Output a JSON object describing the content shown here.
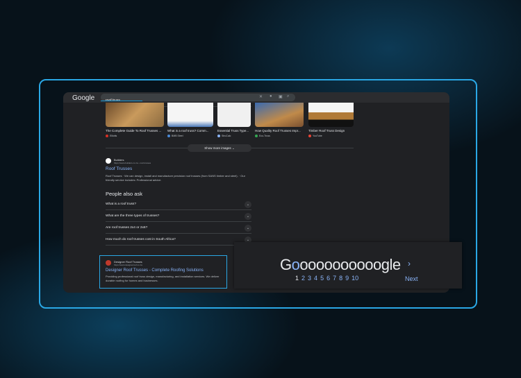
{
  "header": {
    "logo": "Google",
    "query": "roof truss"
  },
  "images": [
    {
      "caption": "The Complete Guide To Roof Trusses ...",
      "source": "Elliotts",
      "color": "#d93025"
    },
    {
      "caption": "What is a roof truss? Comm...",
      "source": "BMB Steel",
      "color": "#4a8ad8"
    },
    {
      "caption": "Essential Truss Type...",
      "source": "StruCalc",
      "color": "#8ab4f8"
    },
    {
      "caption": "How Quality Roof Trusses Impr...",
      "source": "Eco-Truss",
      "color": "#34a853"
    },
    {
      "caption": "Timber Roof Truss Design",
      "source": "YouTube",
      "color": "#ea4335"
    }
  ],
  "show_more": "Show more images ⌄",
  "result1": {
    "site": "Builders",
    "url": "https://www.builders.co.za › roof-trusses",
    "title": "Roof Trusses",
    "snippet": "Roof Trusses · We can design, install and manufacture precision roof trusses (from SANS timber and steel). · Our friendly service includes: Professional advice."
  },
  "paa": {
    "title": "People also ask",
    "questions": [
      "What is a roof truss?",
      "What are the three types of trusses?",
      "Are roof trusses 2x4 or 2x6?",
      "How much do roof trusses cost in South Africa?"
    ]
  },
  "result2": {
    "site": "Designer Roof Trusses",
    "url": "https://www.designerroof.co.za",
    "title": "Designer Roof Trusses - Complete Roofing Solutions",
    "snippet": "Providing professional roof truss design, manufacturing, and installation services. We deliver durable roofing for homes and businesses."
  },
  "pagination": {
    "logo_start": "G",
    "logo_blue": "o",
    "logo_rest": "oooooooooogle",
    "pages": [
      "1",
      "2",
      "3",
      "4",
      "5",
      "6",
      "7",
      "8",
      "9",
      "10"
    ],
    "next": "Next"
  }
}
